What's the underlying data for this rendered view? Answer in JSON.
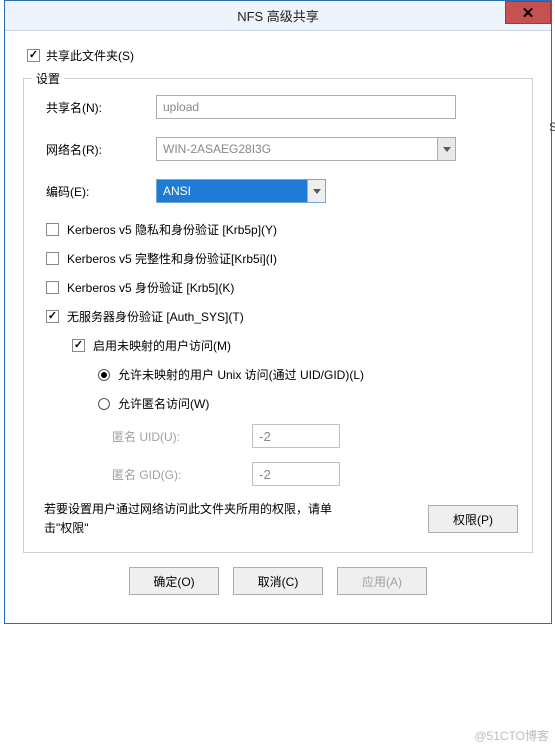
{
  "title": "NFS 高级共享",
  "close_glyph": "✕",
  "share_folder_label": "共享此文件夹(S)",
  "share_folder_checked": true,
  "settings_legend": "设置",
  "share_name": {
    "label": "共享名(N):",
    "value": "upload"
  },
  "network_name": {
    "label": "网络名(R):",
    "value": "WIN-2ASAEG28I3G"
  },
  "encoding": {
    "label": "编码(E):",
    "value": "ANSI"
  },
  "auth": [
    {
      "label": "Kerberos v5 隐私和身份验证 [Krb5p](Y)",
      "checked": false
    },
    {
      "label": "Kerberos v5 完整性和身份验证[Krb5i](I)",
      "checked": false
    },
    {
      "label": "Kerberos v5 身份验证 [Krb5](K)",
      "checked": false
    },
    {
      "label": "无服务器身份验证 [Auth_SYS](T)",
      "checked": true
    }
  ],
  "unmapped": {
    "label": "启用未映射的用户访问(M)",
    "checked": true
  },
  "radios": [
    {
      "label": "允许未映射的用户 Unix 访问(通过 UID/GID)(L)",
      "checked": true
    },
    {
      "label": "允许匿名访问(W)",
      "checked": false
    }
  ],
  "anon_uid": {
    "label": "匿名 UID(U):",
    "value": "-2"
  },
  "anon_gid": {
    "label": "匿名 GID(G):",
    "value": "-2"
  },
  "perm_text": "若要设置用户通过网络访问此文件夹所用的权限，请单击\"权限\"",
  "perm_button": "权限(P)",
  "buttons": {
    "ok": "确定(O)",
    "cancel": "取消(C)",
    "apply": "应用(A)"
  },
  "watermark": "@51CTO博客",
  "side_letter": "S"
}
